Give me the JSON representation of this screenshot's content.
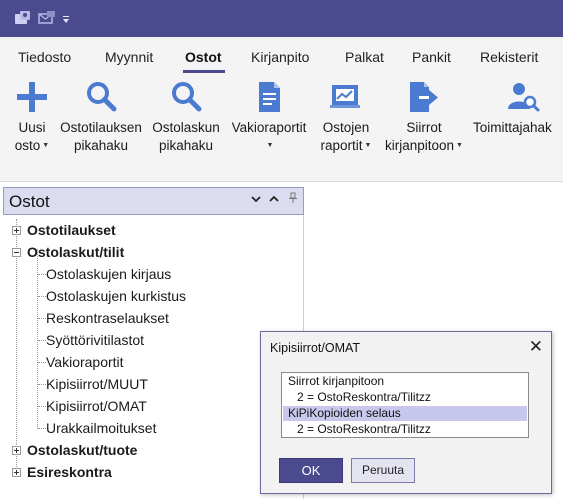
{
  "titlebar": {
    "quick_access": [
      "app-icon",
      "mail-icon",
      "customize-arrow-icon"
    ]
  },
  "tabs": [
    "Tiedosto",
    "Myynnit",
    "Ostot",
    "Kirjanpito",
    "Palkat",
    "Pankit",
    "Rekisterit"
  ],
  "active_tab": "Ostot",
  "ribbon": {
    "uusi_l1": "Uusi",
    "uusi_l2": "osto",
    "ostotilauksen_l1": "Ostotilauksen",
    "ostotilauksen_l2": "pikahaku",
    "ostolaskun_l1": "Ostolaskun",
    "ostolaskun_l2": "pikahaku",
    "vakioraportit_l1": "Vakioraportit",
    "ostojen_l1": "Ostojen",
    "ostojen_l2": "raportit",
    "siirrot_l1": "Siirrot",
    "siirrot_l2": "kirjanpitoon",
    "toimittajahaku_l1": "Toimittajahak"
  },
  "panel": {
    "title": "Ostot",
    "tree": {
      "ostotilaukset": "Ostotilaukset",
      "ostolaskut_tilit": "Ostolaskut/tilit",
      "children": [
        "Ostolaskujen kirjaus",
        "Ostolaskujen kurkistus",
        "Reskontraselaukset",
        "Syöttörivitilastot",
        "Vakioraportit",
        "Kipisiirrot/MUUT",
        "Kipisiirrot/OMAT",
        "Urakkailmoitukset"
      ],
      "ostolaskut_tuote": "Ostolaskut/tuote",
      "esireskontra": "Esireskontra"
    }
  },
  "dialog": {
    "title": "Kipisiirrot/OMAT",
    "close_symbol": "✕",
    "items": [
      "Siirrot kirjanpitoon",
      "2 = OstoReskontra/Tilitzz",
      "KiPiKopioiden selaus",
      "2 = OstoReskontra/Tilitzz"
    ],
    "selected_item": "KiPiKopioiden selaus",
    "ok_label": "OK",
    "cancel_label": "Peruuta"
  },
  "colors": {
    "accent": "#4b4a8f",
    "icon_blue": "#4a7bd0",
    "selection": "#c8c8ec",
    "panel_header": "#dcdcf0"
  }
}
